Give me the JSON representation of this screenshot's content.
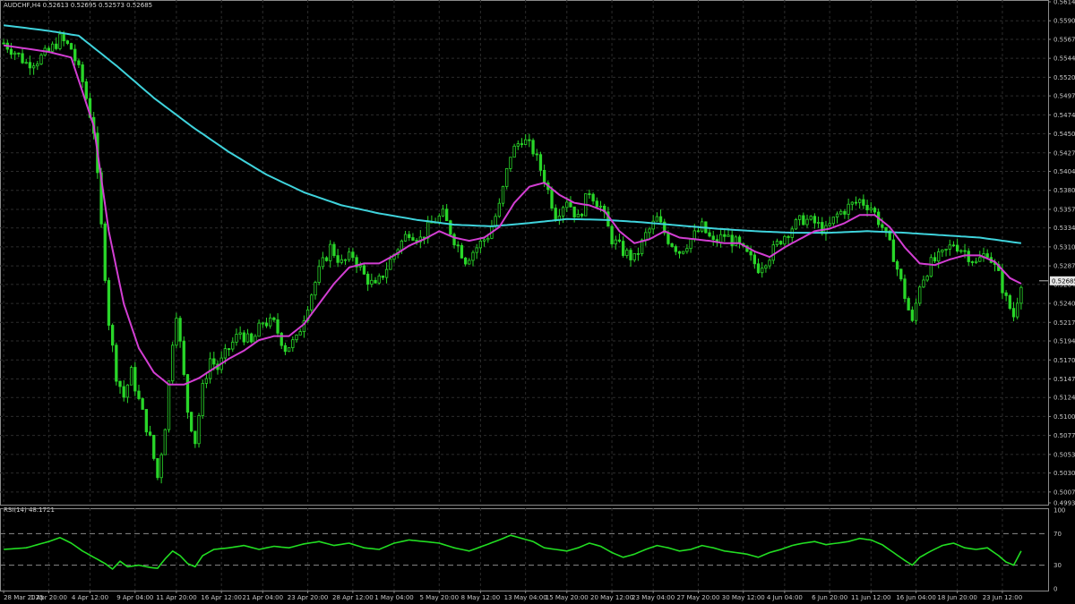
{
  "window": {
    "symbol_line": "AUDCHF,H4  0.52613 0.52695 0.52573 0.52685",
    "rsi_line": "RSI(14) 48.1721"
  },
  "colors": {
    "background": "#000000",
    "grid": "#2c2c2c",
    "candle": "#29d629",
    "ma_fast": "#d23ed2",
    "ma_slow": "#3fd3dc",
    "rsi_line": "#22dd22",
    "text": "#c8c8c8",
    "price_tag_bg": "#e6e6e6"
  },
  "chart_data": [
    {
      "type": "candlestick",
      "symbol": "AUDCHF",
      "timeframe": "H4",
      "ylim": [
        0.49935,
        0.5614
      ],
      "grid": true,
      "y_ticks": [
        "0.56140",
        "0.55905",
        "0.55675",
        "0.55440",
        "0.55205",
        "0.54975",
        "0.54740",
        "0.54505",
        "0.54270",
        "0.54040",
        "0.53805",
        "0.53570",
        "0.53340",
        "0.53105",
        "0.52870",
        "0.52640",
        "0.52405",
        "0.52170",
        "0.51940",
        "0.51705",
        "0.51470",
        "0.51240",
        "0.51005",
        "0.50770",
        "0.50535",
        "0.50305",
        "0.50070",
        "0.49935"
      ],
      "current_price": "0.52685",
      "x_ticks": [
        "28 Mar 2025",
        "1 Apr 20:00",
        "4 Apr 12:00",
        "9 Apr 04:00",
        "11 Apr 20:00",
        "16 Apr 12:00",
        "21 Apr 04:00",
        "23 Apr 20:00",
        "28 Apr 12:00",
        "1 May 04:00",
        "5 May 20:00",
        "8 May 12:00",
        "13 May 04:00",
        "15 May 20:00",
        "20 May 12:00",
        "23 May 04:00",
        "27 May 20:00",
        "30 May 12:00",
        "4 Jun 04:00",
        "6 Jun 20:00",
        "11 Jun 12:00",
        "16 Jun 04:00",
        "18 Jun 20:00",
        "23 Jun 12:00"
      ],
      "close_path": [
        [
          0,
          0.5563
        ],
        [
          3,
          0.5552
        ],
        [
          6,
          0.5538
        ],
        [
          9,
          0.5542
        ],
        [
          12,
          0.5552
        ],
        [
          15,
          0.5568
        ],
        [
          18,
          0.5556
        ],
        [
          21,
          0.5515
        ],
        [
          24,
          0.5455
        ],
        [
          26,
          0.5335
        ],
        [
          28,
          0.5218
        ],
        [
          30,
          0.5152
        ],
        [
          32,
          0.5125
        ],
        [
          34,
          0.5155
        ],
        [
          36,
          0.512
        ],
        [
          39,
          0.5072
        ],
        [
          41,
          0.5025
        ],
        [
          43,
          0.509
        ],
        [
          45,
          0.5195
        ],
        [
          46,
          0.523
        ],
        [
          47,
          0.519
        ],
        [
          49,
          0.5108
        ],
        [
          51,
          0.507
        ],
        [
          53,
          0.5135
        ],
        [
          55,
          0.5172
        ],
        [
          57,
          0.516
        ],
        [
          60,
          0.5185
        ],
        [
          63,
          0.5205
        ],
        [
          66,
          0.519
        ],
        [
          69,
          0.5218
        ],
        [
          72,
          0.5215
        ],
        [
          75,
          0.5185
        ],
        [
          78,
          0.5195
        ],
        [
          81,
          0.524
        ],
        [
          84,
          0.528
        ],
        [
          87,
          0.531
        ],
        [
          90,
          0.529
        ],
        [
          93,
          0.53
        ],
        [
          96,
          0.5275
        ],
        [
          99,
          0.526
        ],
        [
          102,
          0.5285
        ],
        [
          105,
          0.531
        ],
        [
          108,
          0.533
        ],
        [
          111,
          0.532
        ],
        [
          114,
          0.534
        ],
        [
          117,
          0.535
        ],
        [
          120,
          0.532
        ],
        [
          123,
          0.5295
        ],
        [
          126,
          0.531
        ],
        [
          129,
          0.5325
        ],
        [
          132,
          0.536
        ],
        [
          135,
          0.5425
        ],
        [
          138,
          0.5445
        ],
        [
          141,
          0.543
        ],
        [
          144,
          0.5395
        ],
        [
          147,
          0.535
        ],
        [
          150,
          0.537
        ],
        [
          153,
          0.5345
        ],
        [
          156,
          0.538
        ],
        [
          159,
          0.536
        ],
        [
          162,
          0.532
        ],
        [
          165,
          0.5305
        ],
        [
          168,
          0.5295
        ],
        [
          171,
          0.5325
        ],
        [
          174,
          0.5345
        ],
        [
          177,
          0.532
        ],
        [
          180,
          0.5305
        ],
        [
          183,
          0.532
        ],
        [
          186,
          0.5335
        ],
        [
          189,
          0.5315
        ],
        [
          192,
          0.5325
        ],
        [
          195,
          0.5315
        ],
        [
          198,
          0.53
        ],
        [
          201,
          0.5285
        ],
        [
          204,
          0.53
        ],
        [
          207,
          0.532
        ],
        [
          210,
          0.5335
        ],
        [
          213,
          0.5345
        ],
        [
          216,
          0.534
        ],
        [
          219,
          0.533
        ],
        [
          222,
          0.535
        ],
        [
          225,
          0.536
        ],
        [
          228,
          0.5368
        ],
        [
          231,
          0.536
        ],
        [
          234,
          0.5335
        ],
        [
          237,
          0.53
        ],
        [
          240,
          0.525
        ],
        [
          242,
          0.5215
        ],
        [
          244,
          0.5265
        ],
        [
          247,
          0.529
        ],
        [
          250,
          0.53
        ],
        [
          253,
          0.5315
        ],
        [
          256,
          0.5305
        ],
        [
          259,
          0.529
        ],
        [
          262,
          0.5305
        ],
        [
          265,
          0.5275
        ],
        [
          267,
          0.5245
        ],
        [
          269,
          0.5225
        ],
        [
          271,
          0.5268
        ]
      ],
      "bar_count": 272,
      "ma_fast_path": [
        [
          0,
          0.556
        ],
        [
          6,
          0.5556
        ],
        [
          12,
          0.5552
        ],
        [
          18,
          0.5545
        ],
        [
          24,
          0.546
        ],
        [
          28,
          0.533
        ],
        [
          32,
          0.524
        ],
        [
          36,
          0.5185
        ],
        [
          40,
          0.5155
        ],
        [
          44,
          0.514
        ],
        [
          48,
          0.514
        ],
        [
          52,
          0.5148
        ],
        [
          56,
          0.516
        ],
        [
          60,
          0.5172
        ],
        [
          64,
          0.5182
        ],
        [
          68,
          0.5195
        ],
        [
          72,
          0.52
        ],
        [
          76,
          0.52
        ],
        [
          80,
          0.5215
        ],
        [
          84,
          0.524
        ],
        [
          88,
          0.5265
        ],
        [
          92,
          0.5285
        ],
        [
          96,
          0.529
        ],
        [
          100,
          0.529
        ],
        [
          104,
          0.53
        ],
        [
          108,
          0.5312
        ],
        [
          112,
          0.532
        ],
        [
          116,
          0.533
        ],
        [
          120,
          0.5322
        ],
        [
          124,
          0.5318
        ],
        [
          128,
          0.5322
        ],
        [
          132,
          0.5335
        ],
        [
          136,
          0.5365
        ],
        [
          140,
          0.5385
        ],
        [
          144,
          0.539
        ],
        [
          148,
          0.5375
        ],
        [
          152,
          0.5365
        ],
        [
          156,
          0.5362
        ],
        [
          160,
          0.5355
        ],
        [
          164,
          0.533
        ],
        [
          168,
          0.5315
        ],
        [
          172,
          0.532
        ],
        [
          176,
          0.533
        ],
        [
          180,
          0.5322
        ],
        [
          184,
          0.532
        ],
        [
          188,
          0.5318
        ],
        [
          192,
          0.5315
        ],
        [
          196,
          0.5315
        ],
        [
          200,
          0.5305
        ],
        [
          204,
          0.5298
        ],
        [
          208,
          0.531
        ],
        [
          212,
          0.532
        ],
        [
          216,
          0.533
        ],
        [
          220,
          0.5333
        ],
        [
          224,
          0.534
        ],
        [
          228,
          0.535
        ],
        [
          232,
          0.535
        ],
        [
          236,
          0.5335
        ],
        [
          240,
          0.531
        ],
        [
          244,
          0.529
        ],
        [
          248,
          0.5288
        ],
        [
          252,
          0.5295
        ],
        [
          256,
          0.53
        ],
        [
          260,
          0.53
        ],
        [
          264,
          0.5292
        ],
        [
          268,
          0.5272
        ],
        [
          271,
          0.5265
        ]
      ],
      "ma_slow_path": [
        [
          0,
          0.5585
        ],
        [
          12,
          0.5578
        ],
        [
          20,
          0.5572
        ],
        [
          30,
          0.5535
        ],
        [
          40,
          0.5495
        ],
        [
          50,
          0.546
        ],
        [
          60,
          0.5428
        ],
        [
          70,
          0.54
        ],
        [
          80,
          0.5378
        ],
        [
          90,
          0.5362
        ],
        [
          100,
          0.5352
        ],
        [
          110,
          0.5344
        ],
        [
          120,
          0.5338
        ],
        [
          130,
          0.5336
        ],
        [
          140,
          0.534
        ],
        [
          150,
          0.5345
        ],
        [
          160,
          0.5344
        ],
        [
          170,
          0.5341
        ],
        [
          180,
          0.5337
        ],
        [
          190,
          0.5333
        ],
        [
          200,
          0.533
        ],
        [
          210,
          0.5328
        ],
        [
          220,
          0.5328
        ],
        [
          230,
          0.533
        ],
        [
          240,
          0.5328
        ],
        [
          250,
          0.5325
        ],
        [
          260,
          0.5322
        ],
        [
          271,
          0.5315
        ]
      ]
    },
    {
      "type": "line",
      "title": "RSI(14) 48.1721",
      "ylim": [
        0,
        100
      ],
      "y_ticks": [
        "100",
        "70",
        "30",
        "0"
      ],
      "levels": [
        70,
        30
      ],
      "x": "bar_index",
      "series": [
        {
          "values_path": [
            [
              0,
              50
            ],
            [
              6,
              52
            ],
            [
              12,
              60
            ],
            [
              15,
              65
            ],
            [
              18,
              58
            ],
            [
              21,
              48
            ],
            [
              24,
              40
            ],
            [
              27,
              32
            ],
            [
              29,
              25
            ],
            [
              31,
              35
            ],
            [
              33,
              28
            ],
            [
              36,
              30
            ],
            [
              39,
              27
            ],
            [
              41,
              26
            ],
            [
              43,
              38
            ],
            [
              45,
              48
            ],
            [
              47,
              42
            ],
            [
              49,
              32
            ],
            [
              51,
              28
            ],
            [
              53,
              42
            ],
            [
              56,
              50
            ],
            [
              60,
              52
            ],
            [
              64,
              55
            ],
            [
              68,
              50
            ],
            [
              72,
              54
            ],
            [
              76,
              52
            ],
            [
              80,
              57
            ],
            [
              84,
              60
            ],
            [
              88,
              55
            ],
            [
              92,
              58
            ],
            [
              96,
              52
            ],
            [
              100,
              50
            ],
            [
              104,
              58
            ],
            [
              108,
              62
            ],
            [
              112,
              60
            ],
            [
              116,
              58
            ],
            [
              120,
              52
            ],
            [
              124,
              48
            ],
            [
              128,
              55
            ],
            [
              132,
              62
            ],
            [
              135,
              68
            ],
            [
              138,
              64
            ],
            [
              141,
              60
            ],
            [
              144,
              52
            ],
            [
              147,
              50
            ],
            [
              150,
              48
            ],
            [
              153,
              52
            ],
            [
              156,
              58
            ],
            [
              159,
              54
            ],
            [
              162,
              46
            ],
            [
              165,
              40
            ],
            [
              168,
              44
            ],
            [
              171,
              50
            ],
            [
              174,
              55
            ],
            [
              177,
              52
            ],
            [
              180,
              48
            ],
            [
              183,
              50
            ],
            [
              186,
              55
            ],
            [
              189,
              52
            ],
            [
              192,
              48
            ],
            [
              195,
              46
            ],
            [
              198,
              44
            ],
            [
              201,
              40
            ],
            [
              204,
              46
            ],
            [
              207,
              50
            ],
            [
              210,
              55
            ],
            [
              213,
              58
            ],
            [
              216,
              60
            ],
            [
              219,
              56
            ],
            [
              222,
              58
            ],
            [
              225,
              60
            ],
            [
              228,
              64
            ],
            [
              231,
              62
            ],
            [
              234,
              56
            ],
            [
              237,
              46
            ],
            [
              240,
              36
            ],
            [
              242,
              30
            ],
            [
              244,
              40
            ],
            [
              247,
              48
            ],
            [
              250,
              55
            ],
            [
              253,
              58
            ],
            [
              256,
              52
            ],
            [
              259,
              50
            ],
            [
              262,
              52
            ],
            [
              265,
              42
            ],
            [
              267,
              34
            ],
            [
              269,
              30
            ],
            [
              271,
              48
            ]
          ]
        }
      ]
    }
  ]
}
